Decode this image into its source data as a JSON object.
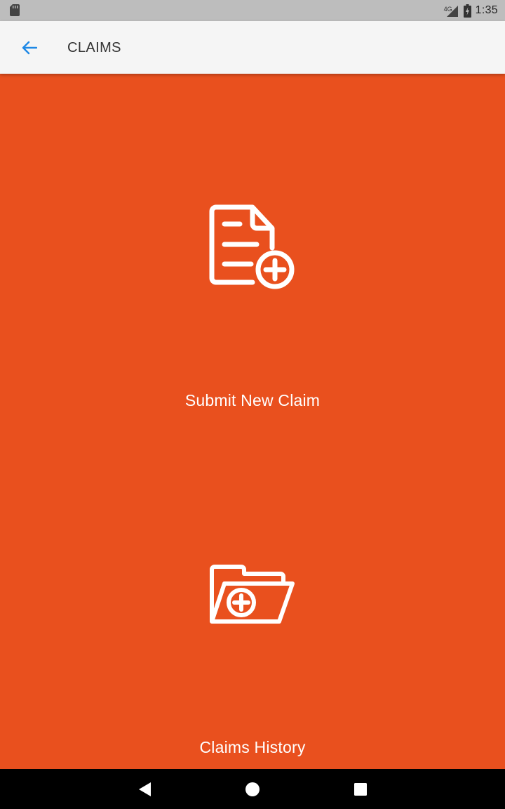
{
  "status_bar": {
    "network": "4G",
    "time": "1:35",
    "icons": [
      "sd-card-icon",
      "signal-icon",
      "battery-charging-icon"
    ]
  },
  "app_bar": {
    "title": "CLAIMS",
    "back_icon": "arrow-back-icon",
    "accent_color": "#1e88e5"
  },
  "main": {
    "background_color": "#e9501e",
    "tiles": [
      {
        "label": "Submit New Claim",
        "icon": "document-add-icon"
      },
      {
        "label": "Claims History",
        "icon": "folder-add-icon"
      }
    ]
  },
  "nav_bar": {
    "buttons": [
      "nav-back-icon",
      "nav-home-icon",
      "nav-recents-icon"
    ]
  }
}
